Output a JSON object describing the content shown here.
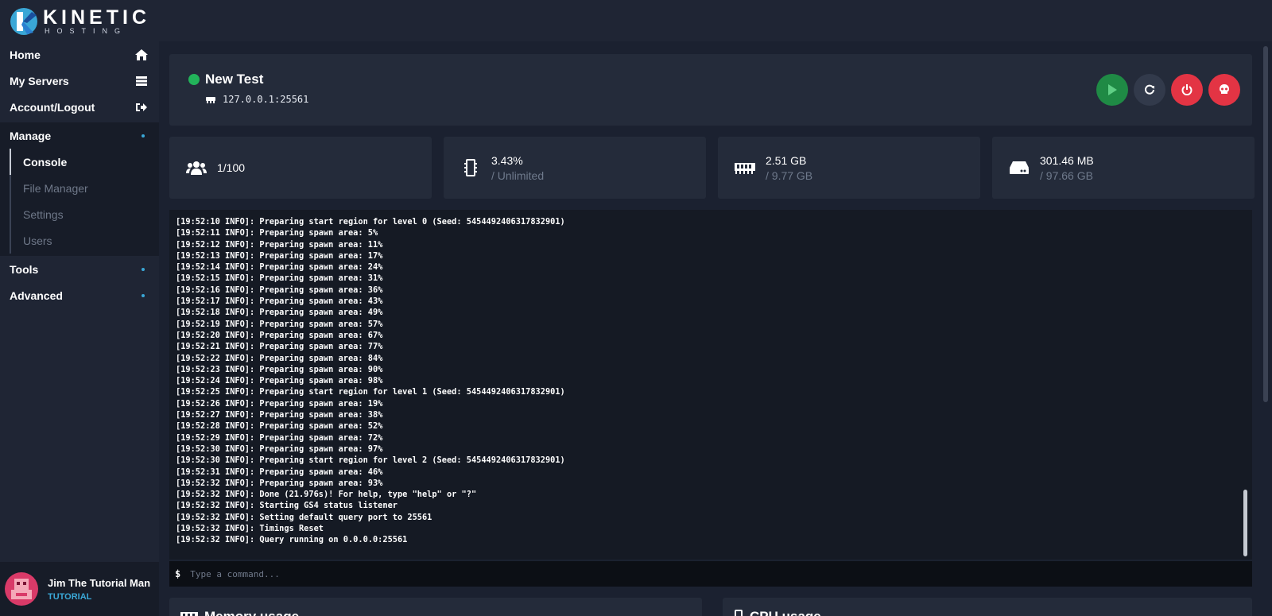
{
  "brand": {
    "name": "KINETIC",
    "tagline": "HOSTING"
  },
  "nav": {
    "home": "Home",
    "servers": "My Servers",
    "account": "Account/Logout",
    "manage": "Manage",
    "manage_items": [
      "Console",
      "File Manager",
      "Settings",
      "Users"
    ],
    "tools": "Tools",
    "advanced": "Advanced"
  },
  "user": {
    "name": "Jim The Tutorial Man",
    "role": "TUTORIAL"
  },
  "server": {
    "name": "New Test",
    "address": "127.0.0.1:25561",
    "status_color": "#22b35a"
  },
  "stats": {
    "players": "1/100",
    "cpu": "3.43%",
    "cpu_limit": "/ Unlimited",
    "memory": "2.51 GB",
    "memory_limit": "/ 9.77 GB",
    "disk": "301.46 MB",
    "disk_limit": "/ 97.66 GB"
  },
  "console": {
    "lines": [
      "[19:52:10 INFO]: Preparing start region for level 0 (Seed: 5454492406317832901)",
      "[19:52:11 INFO]: Preparing spawn area: 5%",
      "[19:52:12 INFO]: Preparing spawn area: 11%",
      "[19:52:13 INFO]: Preparing spawn area: 17%",
      "[19:52:14 INFO]: Preparing spawn area: 24%",
      "[19:52:15 INFO]: Preparing spawn area: 31%",
      "[19:52:16 INFO]: Preparing spawn area: 36%",
      "[19:52:17 INFO]: Preparing spawn area: 43%",
      "[19:52:18 INFO]: Preparing spawn area: 49%",
      "[19:52:19 INFO]: Preparing spawn area: 57%",
      "[19:52:20 INFO]: Preparing spawn area: 67%",
      "[19:52:21 INFO]: Preparing spawn area: 77%",
      "[19:52:22 INFO]: Preparing spawn area: 84%",
      "[19:52:23 INFO]: Preparing spawn area: 90%",
      "[19:52:24 INFO]: Preparing spawn area: 98%",
      "[19:52:25 INFO]: Preparing start region for level 1 (Seed: 5454492406317832901)",
      "[19:52:26 INFO]: Preparing spawn area: 19%",
      "[19:52:27 INFO]: Preparing spawn area: 38%",
      "[19:52:28 INFO]: Preparing spawn area: 52%",
      "[19:52:29 INFO]: Preparing spawn area: 72%",
      "[19:52:30 INFO]: Preparing spawn area: 97%",
      "[19:52:30 INFO]: Preparing start region for level 2 (Seed: 5454492406317832901)",
      "[19:52:31 INFO]: Preparing spawn area: 46%",
      "[19:52:32 INFO]: Preparing spawn area: 93%",
      "[19:52:32 INFO]: Done (21.976s)! For help, type \"help\" or \"?\"",
      "[19:52:32 INFO]: Starting GS4 status listener",
      "[19:52:32 INFO]: Setting default query port to 25561",
      "[19:52:32 INFO]: Timings Reset",
      "[19:52:32 INFO]: Query running on 0.0.0.0:25561"
    ],
    "prompt": "$",
    "placeholder": "Type a command..."
  },
  "panels": {
    "memory_title": "Memory usage",
    "cpu_title": "CPU usage"
  },
  "colors": {
    "accent": "#3aa7d6",
    "start": "#1f8a45",
    "danger": "#e33444",
    "online": "#22b35a"
  },
  "icons": {
    "home": "home-icon",
    "servers": "server-list-icon",
    "account": "logout-icon",
    "players": "users-icon",
    "cpu": "cpu-chip-icon",
    "memory": "memory-icon",
    "disk": "hard-drive-icon",
    "start": "play-icon",
    "restart": "restart-icon",
    "stop": "power-icon",
    "kill": "skull-icon"
  }
}
